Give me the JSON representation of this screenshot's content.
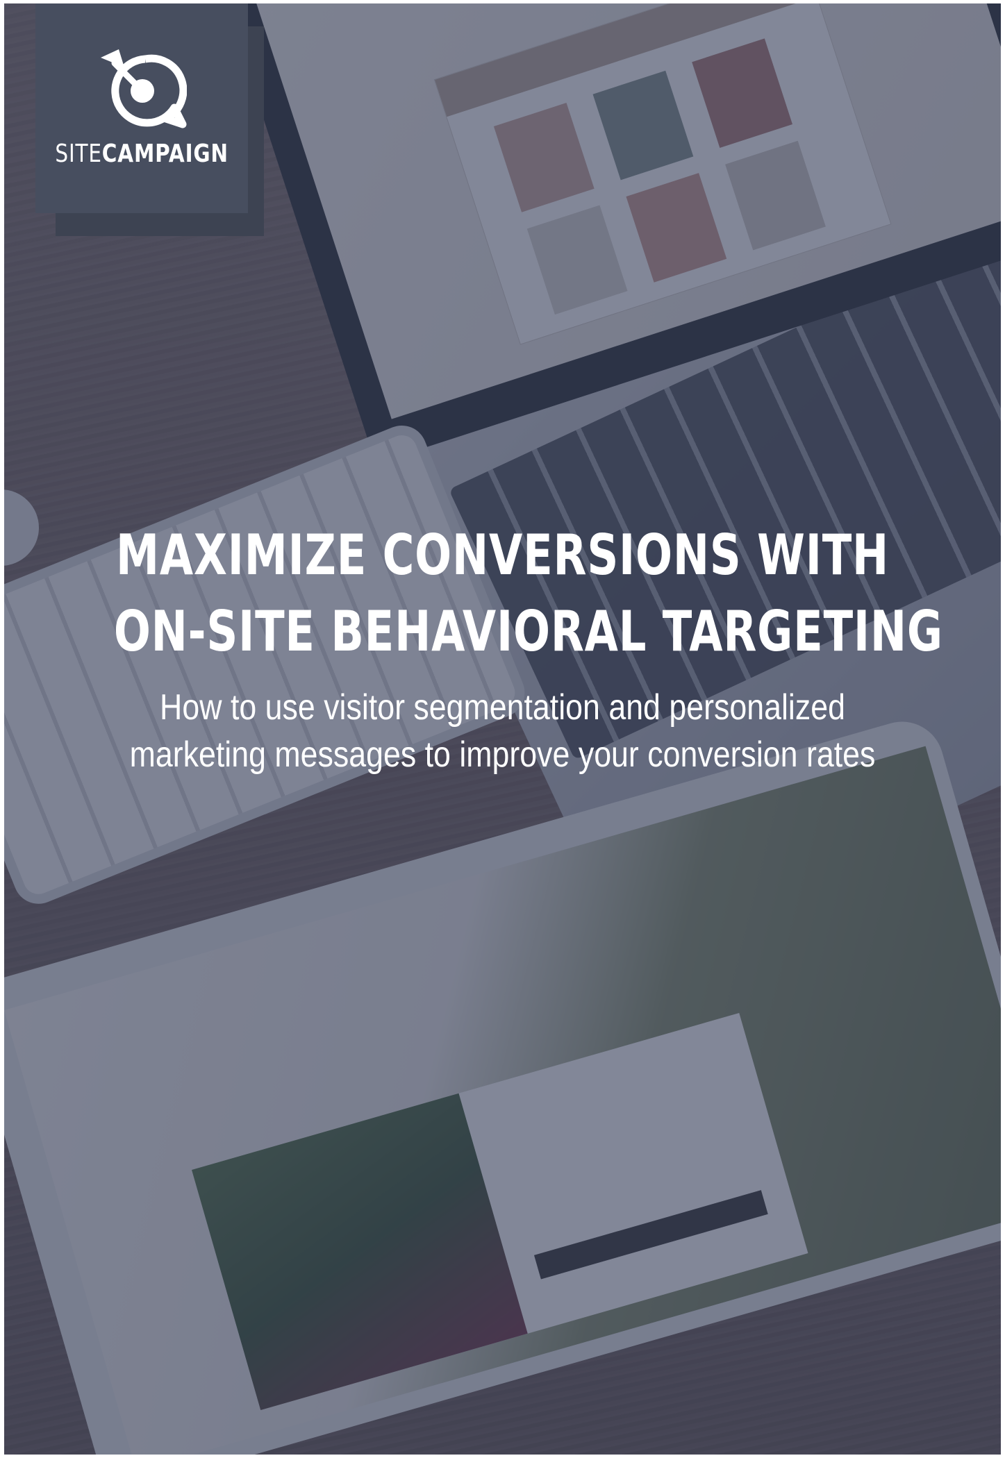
{
  "brand": {
    "name_light": "SITE",
    "name_bold": "CAMPAIGN",
    "icon": "sitecampaign-target-icon"
  },
  "cover": {
    "title_line1": "MAXIMIZE CONVERSIONS WITH",
    "title_line2": "ON-SITE BEHAVIORAL TARGETING",
    "subtitle_line1": "How to use visitor segmentation and personalized",
    "subtitle_line2": "marketing messages to improve your conversion rates"
  },
  "colors": {
    "overlay": "#363e58",
    "logo_box": "#474e5f",
    "logo_shadow": "#3d4352",
    "text": "#ffffff"
  }
}
